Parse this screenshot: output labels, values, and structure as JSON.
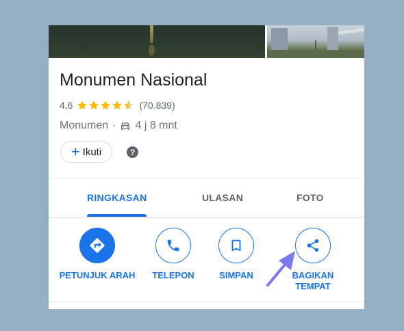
{
  "place": {
    "name": "Monumen Nasional",
    "rating": "4,6",
    "stars_value": 4.6,
    "review_count": "(70.839)",
    "category": "Monumen",
    "separator": "·",
    "travel_time": "4 j 8 mnt"
  },
  "follow": {
    "plus": "+",
    "label": "Ikuti"
  },
  "help": {
    "symbol": "?"
  },
  "tabs": [
    {
      "label": "RINGKASAN",
      "active": true
    },
    {
      "label": "ULASAN",
      "active": false
    },
    {
      "label": "FOTO",
      "active": false
    }
  ],
  "actions": [
    {
      "label": "PETUNJUK ARAH",
      "icon": "directions-icon"
    },
    {
      "label": "TELEPON",
      "icon": "phone-icon"
    },
    {
      "label": "SIMPAN",
      "icon": "bookmark-icon"
    },
    {
      "label": "BAGIKAN\nTEMPAT",
      "icon": "share-icon"
    }
  ],
  "colors": {
    "accent": "#1a73e8",
    "star": "#fbbc04",
    "annotation_arrow": "#7b78f0",
    "background": "#97afc2"
  }
}
